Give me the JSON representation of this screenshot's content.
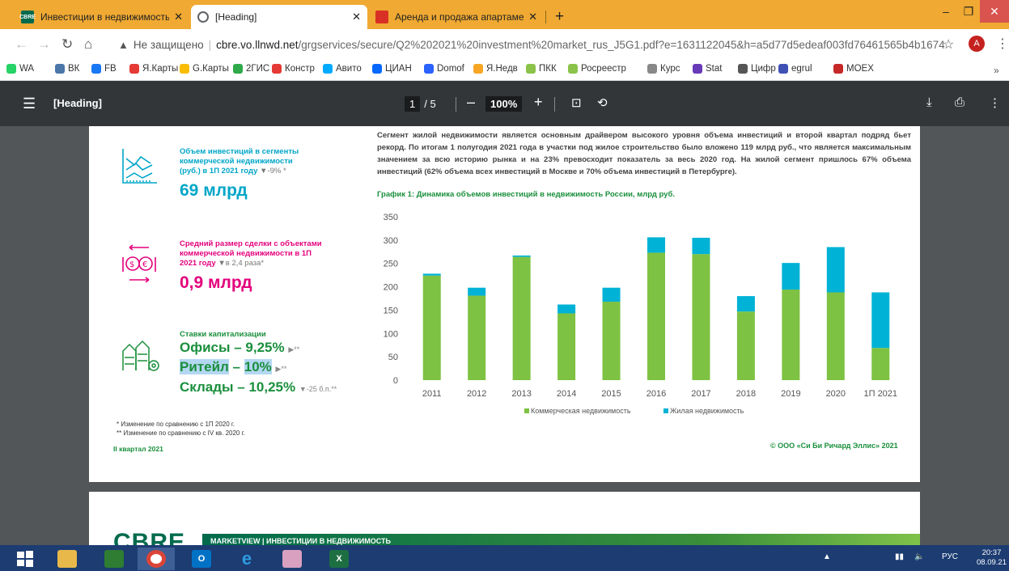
{
  "browser": {
    "tabs": [
      {
        "title": "Инвестиции в недвижимость Р",
        "favicon_text": "CBRE",
        "favicon_color": "#006a4d",
        "active": false
      },
      {
        "title": "[Heading]",
        "favicon_text": "",
        "favicon_color": "#5f6368",
        "active": true
      },
      {
        "title": "Аренда и продажа апартаменто",
        "favicon_text": "",
        "favicon_color": "#d93025",
        "active": false
      }
    ],
    "url": {
      "warning": "Не защищено",
      "domain": "cbre.vo.llnwd.net",
      "path": "/grgservices/secure/Q2%202021%20investment%20market_rus_J5G1.pdf?e=1631122045&h=a5d77d5edeaf003fd76461565b4b1674"
    },
    "profile_letter": "A",
    "bookmarks": [
      {
        "label": "WA",
        "color": "#25d366"
      },
      {
        "label": "ВК",
        "color": "#4a76a8"
      },
      {
        "label": "FB",
        "color": "#1877f2"
      },
      {
        "label": "Я.Карты",
        "color": "#e53935"
      },
      {
        "label": "G.Карты",
        "color": "#fbbc04"
      },
      {
        "label": "2ГИС",
        "color": "#2eaa4a"
      },
      {
        "label": "Констр",
        "color": "#e53935"
      },
      {
        "label": "Авито",
        "color": "#00aaff"
      },
      {
        "label": "ЦИАН",
        "color": "#0468ff"
      },
      {
        "label": "Domof",
        "color": "#2962ff"
      },
      {
        "label": "Я.Недв",
        "color": "#f6a623"
      },
      {
        "label": "ПКК",
        "color": "#8bc34a"
      },
      {
        "label": "Росреестр",
        "color": "#8bc34a"
      },
      {
        "label": "Курс",
        "color": "#888888"
      },
      {
        "label": "Stat",
        "color": "#673ab7"
      },
      {
        "label": "Цифр",
        "color": "#555555"
      },
      {
        "label": "egrul",
        "color": "#3f51b5"
      },
      {
        "label": "MOEX",
        "color": "#c62828"
      }
    ]
  },
  "pdf_toolbar": {
    "title": "[Heading]",
    "page_current": "1",
    "page_total": "/ 5",
    "zoom": "100%"
  },
  "report": {
    "stats": {
      "commercial": {
        "label_line1": "Объем инвестиций в сегменты",
        "label_line2": "коммерческой недвижимости",
        "label_line3": "(руб.) в 1П 2021 году",
        "label_change": "▼-9% *",
        "value": "69 млрд"
      },
      "deal_size": {
        "label_line1": "Средний размер сделки с объектами",
        "label_line2": "коммерческой недвижимости в 1П",
        "label_line3": "2021 году",
        "label_change": "▼в 2,4 раза*",
        "value": "0,9 млрд"
      },
      "cap_rates": {
        "label": "Ставки капитализации",
        "offices": "Офисы – 9,25%",
        "offices_tri": "▶**",
        "retail_a": "Ритейл",
        "retail_b": " – ",
        "retail_c": "10%",
        "retail_tri": "▶**",
        "warehouses": "Склады –  10,25%",
        "warehouses_tri": "▼-25 б.п.**"
      }
    },
    "footnote1": "*   Изменение по сравнению с 1П 2020 г.",
    "footnote2": "** Изменение по сравнению с IV кв. 2020 г.",
    "quarter": "II квартал 2021",
    "copyright": "© ООО «Си Би Ричард Эллис» 2021",
    "paragraph": "Сегмент жилой недвижимости является основным драйвером высокого уровня объема инвестиций и второй квартал подряд бьет рекорд. По итогам 1 полугодия 2021 года в участки под жилое строительство было вложено 119 млрд руб., что является максимальным значением за всю историю рынка и на 23% превосходит показатель за весь 2020 год. На жилой сегмент пришлось 67% объема инвестиций (62% объема всех инвестиций в Москве и 70% объема инвестиций в Петербурге).",
    "chart_title": "График 1: Динамика объемов инвестиций в недвижимость России, млрд руб.",
    "page2_brand": "CBRE",
    "page2_band": "MARKETVIEW | ИНВЕСТИЦИИ В НЕДВИЖИМОСТЬ"
  },
  "chart_data": {
    "type": "bar",
    "stacked": true,
    "title": "График 1: Динамика объемов инвестиций в недвижимость России, млрд руб.",
    "categories": [
      "2011",
      "2012",
      "2013",
      "2014",
      "2015",
      "2016",
      "2017",
      "2018",
      "2019",
      "2020",
      "1П 2021"
    ],
    "series": [
      {
        "name": "Коммерческая недвижимость",
        "color": "#7dc242",
        "values": [
          224,
          181,
          264,
          143,
          168,
          273,
          270,
          147,
          194,
          188,
          69
        ]
      },
      {
        "name": "Жилая недвижимость",
        "color": "#00b2d6",
        "values": [
          4,
          17,
          3,
          19,
          30,
          33,
          35,
          33,
          57,
          97,
          119
        ]
      }
    ],
    "ylim": [
      0,
      350
    ],
    "yticks": [
      0,
      50,
      100,
      150,
      200,
      250,
      300,
      350
    ],
    "grid": false,
    "legend": "bottom"
  },
  "taskbar": {
    "lang": "РУС",
    "time": "20:37",
    "date": "08.09.21"
  }
}
